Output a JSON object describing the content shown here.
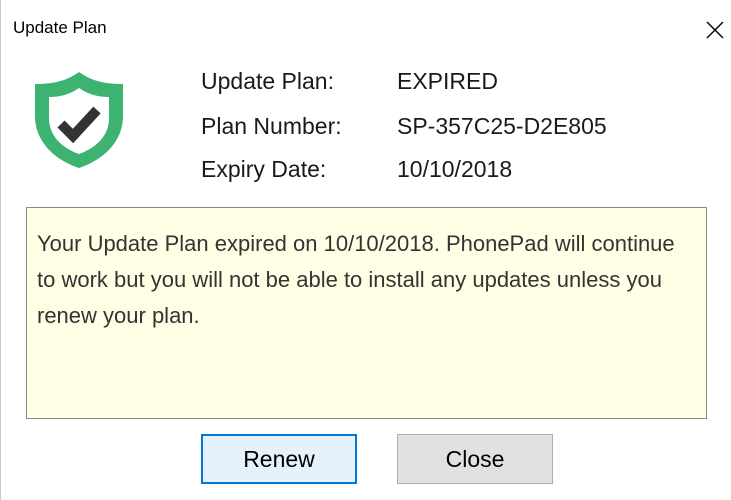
{
  "window": {
    "title": "Update Plan"
  },
  "plan": {
    "status_label": "Update Plan:",
    "status_value": "EXPIRED",
    "number_label": "Plan Number:",
    "number_value": "SP-357C25-D2E805",
    "expiry_label": "Expiry Date:",
    "expiry_value": "10/10/2018"
  },
  "message": "Your Update Plan expired on 10/10/2018. PhonePad will continue to work but you will not be able to install any updates unless you renew your plan.",
  "buttons": {
    "renew": "Renew",
    "close": "Close"
  },
  "icons": {
    "shield": "shield-check-icon",
    "close": "close-icon"
  },
  "colors": {
    "shield_green": "#3cb371",
    "checkmark": "#333333",
    "message_bg": "#ffffe6",
    "default_button_border": "#0078d7"
  }
}
